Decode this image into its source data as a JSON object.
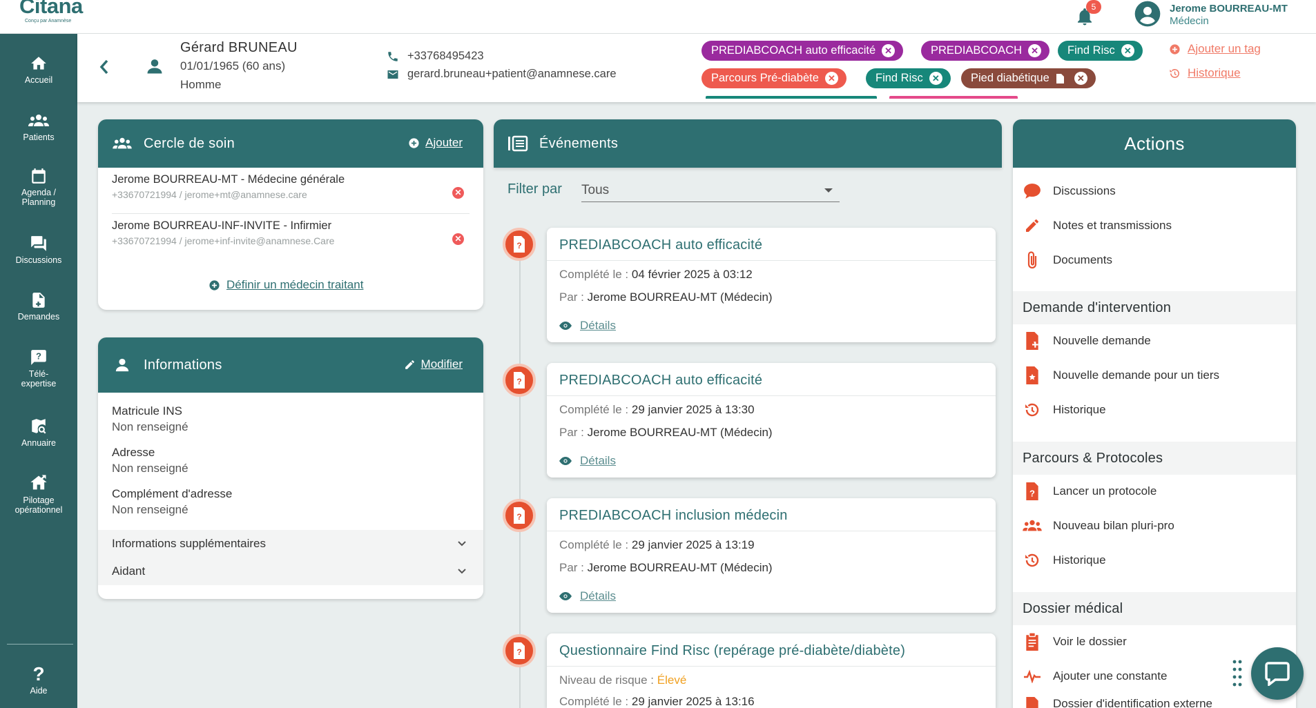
{
  "app": {
    "logo": "Citana",
    "logo_sub": "Conçu par Anamnèse",
    "notifications_count": "5",
    "user_name": "Jerome BOURREAU-MT",
    "user_role": "Médecin"
  },
  "sidebar": {
    "items": [
      {
        "label": "Accueil",
        "icon": "home-icon"
      },
      {
        "label": "Patients",
        "icon": "people-icon"
      },
      {
        "label": "Agenda / Planning",
        "icon": "calendar-icon"
      },
      {
        "label": "Discussions",
        "icon": "chat-icon"
      },
      {
        "label": "Demandes",
        "icon": "request-icon"
      },
      {
        "label": "Télé-expertise",
        "icon": "question-icon"
      },
      {
        "label": "Annuaire",
        "icon": "directory-icon"
      },
      {
        "label": "Pilotage opérationnel",
        "icon": "pilot-icon"
      }
    ],
    "help": "Aide"
  },
  "patient": {
    "name": "Gérard BRUNEAU",
    "dob": "01/01/1965 (60 ans)",
    "sex": "Homme",
    "phone": "+33768495423",
    "email": "gerard.bruneau+patient@anamnese.care"
  },
  "tags": [
    {
      "label": "PREDIABCOACH auto efficacité",
      "color": "#9a2a9e"
    },
    {
      "label": "PREDIABCOACH",
      "color": "#9a2a9e"
    },
    {
      "label": "Find Risc",
      "color": "#17877a"
    },
    {
      "label": "Parcours Pré-diabète",
      "color": "#ee5a4e"
    },
    {
      "label": "Find Risc",
      "color": "#17877a"
    },
    {
      "label": "Pied diabétique",
      "color": "#8a4a3c"
    }
  ],
  "tag_links": {
    "add": "Ajouter un tag",
    "history": "Historique"
  },
  "care_circle": {
    "title": "Cercle de soin",
    "add": "Ajouter",
    "members": [
      {
        "name": "Jerome BOURREAU-MT - Médecine générale",
        "contact": "+33670721994 / jerome+mt@anamnese.care"
      },
      {
        "name": "Jerome BOURREAU-INF-INVITE - Infirmier",
        "contact": "+33670721994 / jerome+inf-invite@anamnese.Care"
      }
    ],
    "define_doctor": "Définir un médecin traitant"
  },
  "info": {
    "title": "Informations",
    "edit": "Modifier",
    "fields": [
      {
        "label": "Matricule INS",
        "value": "Non renseigné"
      },
      {
        "label": "Adresse",
        "value": "Non renseigné"
      },
      {
        "label": "Complément d'adresse",
        "value": "Non renseigné"
      }
    ],
    "accordions": [
      "Informations supplémentaires",
      "Aidant"
    ]
  },
  "events": {
    "title": "Événements",
    "filter_label": "Filter par",
    "filter_value": "Tous",
    "completed_prefix": "Complété le : ",
    "by_prefix": "Par : ",
    "details": "Détails",
    "risk_prefix": "Niveau de risque : ",
    "items": [
      {
        "title": "PREDIABCOACH auto efficacité",
        "date": "04 février 2025 à 03:12",
        "by": "Jerome BOURREAU-MT (Médecin)"
      },
      {
        "title": "PREDIABCOACH auto efficacité",
        "date": "29 janvier 2025 à 13:30",
        "by": "Jerome BOURREAU-MT (Médecin)"
      },
      {
        "title": "PREDIABCOACH inclusion médecin",
        "date": "29 janvier 2025 à 13:19",
        "by": "Jerome BOURREAU-MT (Médecin)"
      },
      {
        "title": "Questionnaire Find Risc (repérage pré-diabète/diabète)",
        "risk": "Élevé",
        "risk_color": "#f0a020",
        "date": "29 janvier 2025 à 13:16"
      }
    ]
  },
  "actions": {
    "title": "Actions",
    "top": [
      "Discussions",
      "Notes et transmissions",
      "Documents"
    ],
    "section_intervention": "Demande d'intervention",
    "intervention": [
      "Nouvelle demande",
      "Nouvelle demande pour un tiers",
      "Historique"
    ],
    "section_parcours": "Parcours & Protocoles",
    "parcours": [
      "Lancer un protocole",
      "Nouveau bilan pluri-pro",
      "Historique"
    ],
    "section_dossier": "Dossier médical",
    "dossier": [
      "Voir le dossier",
      "Ajouter une constante",
      "Dossier d'identification externe"
    ],
    "accent_color": "#e5502f"
  }
}
